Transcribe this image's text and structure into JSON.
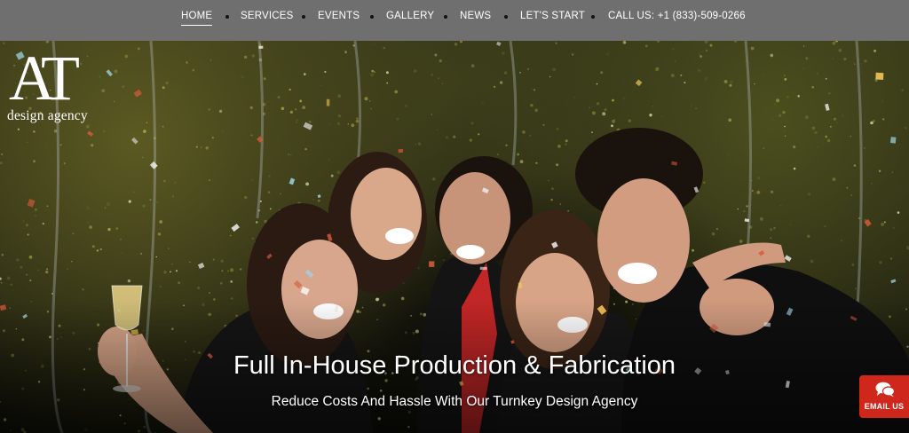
{
  "nav": {
    "items": [
      {
        "label": "HOME",
        "active": true
      },
      {
        "label": "SERVICES"
      },
      {
        "label": "EVENTS"
      },
      {
        "label": "GALLERY"
      },
      {
        "label": "NEWS"
      },
      {
        "label": "LET'S START"
      },
      {
        "label": "CALL US: +1 (833)-509-0266"
      }
    ]
  },
  "logo": {
    "mark": "AT",
    "subtitle": "design agency"
  },
  "hero": {
    "headline": "Full In-House Production & Fabrication",
    "subheadline": "Reduce Costs And Hassle With Our Turnkey Design Agency"
  },
  "email_widget": {
    "label": "EMAIL US",
    "icon": "chat-bubbles-icon",
    "color": "#d0271d"
  },
  "colors": {
    "nav_background": "#6f6f6f",
    "text": "#ffffff"
  }
}
